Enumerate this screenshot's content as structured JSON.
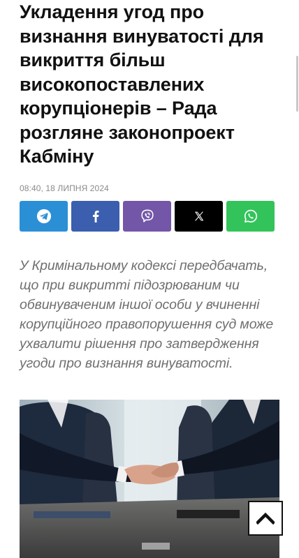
{
  "article": {
    "title": "Укладення угод про визнання винуватості для викриття більш високопоставлених корупціонерів – Рада розгляне законопроект Кабміну",
    "date": "08:40, 18 ЛИПНЯ 2024",
    "lead": "У Кримінальному кодексі передбачать, що при викритті підозрюваним чи обвинуваченим іншої особи у вчиненні корупційного правопорушення суд може ухвалити рішення про затвердження угоди про визнання винуватості."
  },
  "share": {
    "buttons": [
      {
        "name": "telegram",
        "icon": "telegram-icon",
        "color": "#2b8fd6"
      },
      {
        "name": "facebook",
        "icon": "facebook-icon",
        "color": "#3b5fae"
      },
      {
        "name": "viber",
        "icon": "viber-icon",
        "color": "#7356a8"
      },
      {
        "name": "x",
        "icon": "x-icon",
        "color": "#000000"
      },
      {
        "name": "whatsapp",
        "icon": "whatsapp-icon",
        "color": "#32c45a"
      }
    ]
  },
  "image": {
    "depicts": "handshake-photo"
  },
  "controls": {
    "scroll_top_icon": "chevron-up-icon"
  }
}
